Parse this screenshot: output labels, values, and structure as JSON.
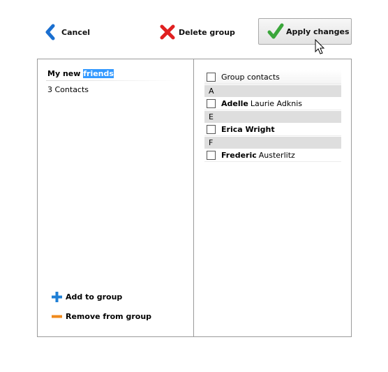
{
  "toolbar": {
    "cancel_label": "Cancel",
    "delete_label": "Delete group",
    "apply_label": "Apply changes"
  },
  "colors": {
    "cancel_icon": "#1a6fd0",
    "delete_icon": "#e02020",
    "apply_icon": "#3aa63a",
    "selection": "#3399ff",
    "add_icon": "#1e7fd6",
    "remove_icon": "#f08a1c"
  },
  "group": {
    "name_plain": "My new ",
    "name_selected": "friends",
    "contacts_count": "3 Contacts"
  },
  "actions": {
    "add_label": "Add to group",
    "remove_label": "Remove from group"
  },
  "contacts": {
    "header": "Group contacts",
    "sections": [
      {
        "letter": "A",
        "items": [
          {
            "first": "Adelle",
            "rest": "Laurie Adknis"
          }
        ]
      },
      {
        "letter": "E",
        "items": [
          {
            "first": "Erica Wright",
            "rest": ""
          }
        ]
      },
      {
        "letter": "F",
        "items": [
          {
            "first": "Frederic",
            "rest": "Austerlitz"
          }
        ]
      }
    ]
  }
}
